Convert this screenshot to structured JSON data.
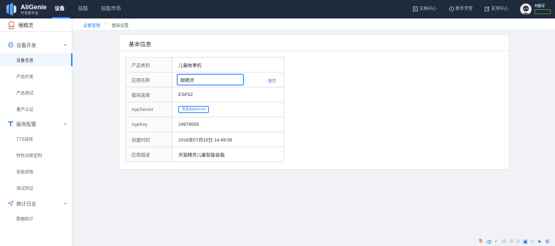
{
  "brand": {
    "title": "AliGenie",
    "subtitle": "开发者平台"
  },
  "nav": {
    "device": "设备",
    "skill": "技能",
    "skill_market": "技能市场"
  },
  "toolbar": {
    "docs": "文档中心",
    "newbie": "新手学堂",
    "support": "支持中心"
  },
  "user": {
    "name": "何雅军",
    "tag": ""
  },
  "sidebar": {
    "device_name": "眼精灵",
    "groups": [
      {
        "label": "设备开发",
        "items": [
          "设备信息",
          "产品开发",
          "产品测试",
          "量产认证"
        ]
      },
      {
        "label": "服务配置",
        "items": [
          "TTS选择",
          "特色词审定制",
          "技能获取",
          "测试验证"
        ]
      },
      {
        "label": "统计日志",
        "items": [
          "数据统计"
        ]
      }
    ]
  },
  "breadcrumb": {
    "parent": "设备管理",
    "separator": "/",
    "current": "基础设置"
  },
  "card": {
    "title": "基本信息"
  },
  "info": {
    "product_type_label": "产品类别",
    "product_type": "儿童故事机",
    "app_name_label": "应用名称",
    "app_name": "眼精灵",
    "save": "保存",
    "module_label": "模块选择",
    "module": "ESP32",
    "secret_label": "AppSecret",
    "secret_button": "查看AppSecret",
    "key_label": "AppKey",
    "key": "24974509",
    "created_label": "创建时间",
    "created": "2018年07月19日 14:49:09",
    "desc_label": "应用描述",
    "desc": "天猫精灵儿童智能音箱"
  },
  "tray": [
    "S",
    "中",
    "♪",
    "⚇",
    "☺",
    "♫",
    "▣",
    "☆",
    "★",
    "⚙"
  ],
  "colors": {
    "topbar": "#1f2a3c",
    "accent": "#2f86f6",
    "background": "#f0f2f5"
  }
}
